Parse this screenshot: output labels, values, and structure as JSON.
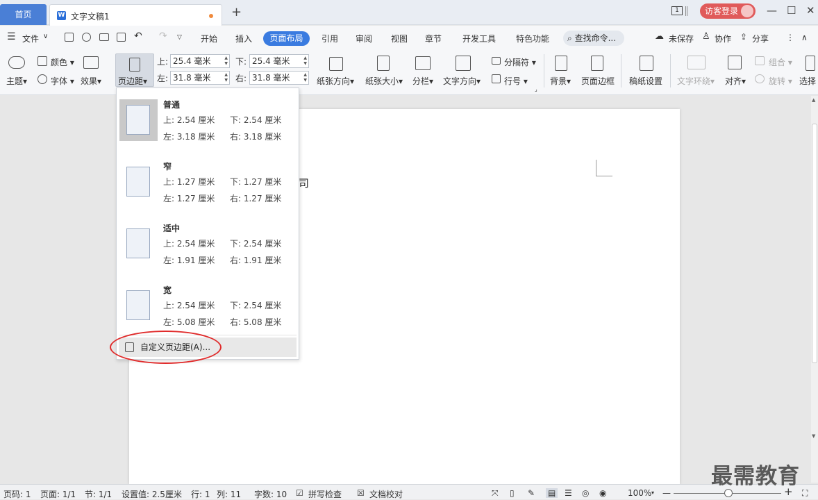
{
  "titlebar": {
    "home_tab": "首页",
    "doc_tab": "文字文稿1",
    "add_tab": "+",
    "login": "访客登录",
    "tabs_count": "1",
    "win_min": "—",
    "win_max": "☐",
    "win_close": "✕"
  },
  "menubar": {
    "hamburger": "☰",
    "file": "文件",
    "file_arrow": "∨",
    "items": [
      "开始",
      "插入",
      "页面布局",
      "引用",
      "审阅",
      "视图",
      "章节",
      "开发工具",
      "特色功能"
    ],
    "active": "页面布局",
    "search": "查找命令...",
    "unsaved": "未保存",
    "collab": "协作",
    "share": "分享",
    "more": "⋮",
    "collapse": "∧"
  },
  "toolbar": {
    "theme": "主题",
    "color": "颜色",
    "font": "字体",
    "effect": "效果",
    "margin": "页边距",
    "top_label": "上:",
    "top_value": "25.4 毫米",
    "bottom_label": "下:",
    "bottom_value": "25.4 毫米",
    "left_label": "左:",
    "left_value": "31.8 毫米",
    "right_label": "右:",
    "right_value": "31.8 毫米",
    "orientation": "纸张方向",
    "size": "纸张大小",
    "columns": "分栏",
    "text_dir": "文字方向",
    "separator": "分隔符",
    "line_num": "行号",
    "background": "背景",
    "page_border": "页面边框",
    "manuscript": "稿纸设置",
    "text_wrap": "文字环绕",
    "align": "对齐",
    "group": "组合",
    "rotate": "旋转",
    "select": "选择"
  },
  "margin_menu": {
    "options": [
      {
        "name": "普通",
        "top": "上: 2.54 厘米",
        "bottom": "下: 2.54 厘米",
        "left": "左: 3.18 厘米",
        "right": "右: 3.18 厘米"
      },
      {
        "name": "窄",
        "top": "上: 1.27 厘米",
        "bottom": "下: 1.27 厘米",
        "left": "左: 1.27 厘米",
        "right": "右: 1.27 厘米"
      },
      {
        "name": "适中",
        "top": "上: 2.54 厘米",
        "bottom": "下: 2.54 厘米",
        "left": "左: 1.91 厘米",
        "right": "右: 1.91 厘米"
      },
      {
        "name": "宽",
        "top": "上: 2.54 厘米",
        "bottom": "下: 2.54 厘米",
        "left": "左: 5.08 厘米",
        "right": "右: 5.08 厘米"
      }
    ],
    "custom": "自定义页边距(A)..."
  },
  "document": {
    "partial_text": "司"
  },
  "statusbar": {
    "page_code": "页码: 1",
    "page": "页面: 1/1",
    "section": "节: 1/1",
    "setting": "设置值: 2.5厘米",
    "row": "行: 1",
    "col": "列: 11",
    "words": "字数: 10",
    "spell": "拼写检查",
    "proof": "文档校对",
    "zoom": "100%",
    "zoom_minus": "—",
    "zoom_plus": "+"
  },
  "watermark": "最需教育"
}
